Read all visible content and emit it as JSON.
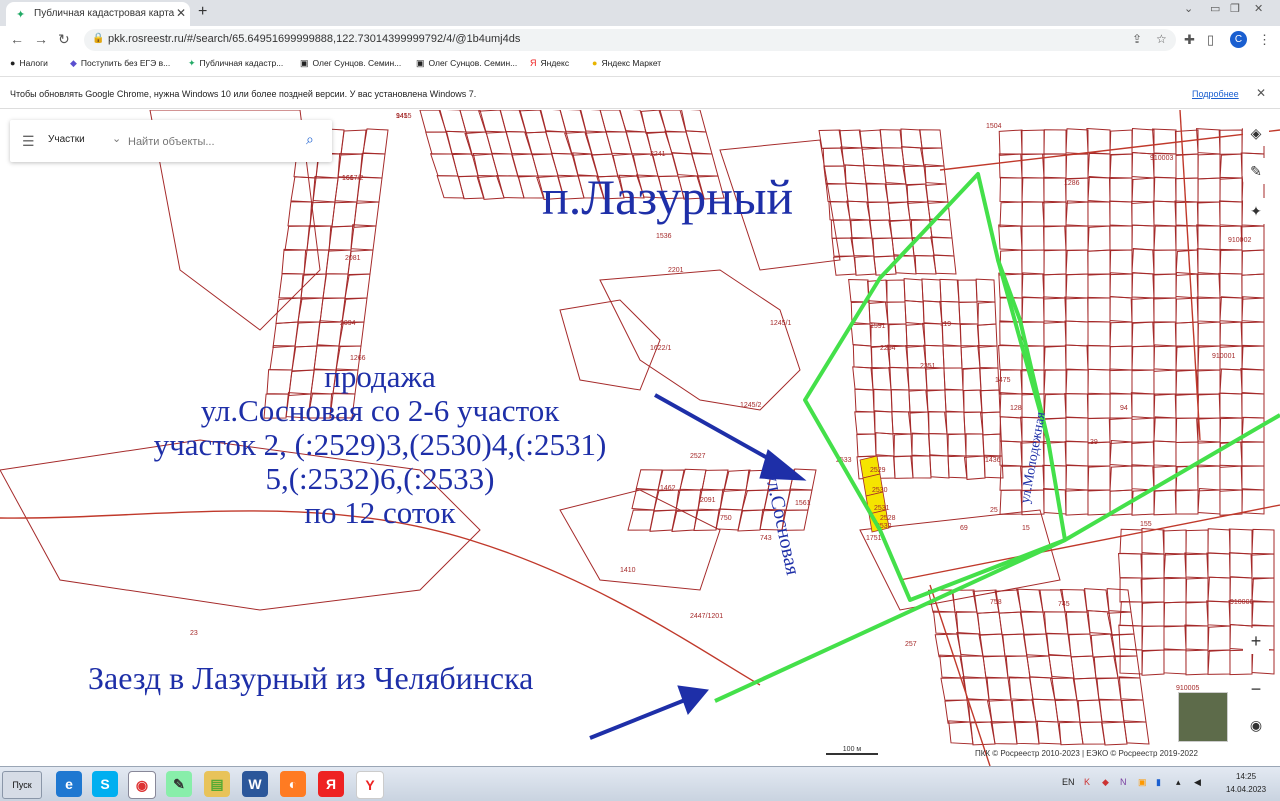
{
  "browser": {
    "tab_title": "Публичная кадастровая карта",
    "url": "pkk.rosreestr.ru/#/search/65.64951699999888,122.73014399999792/4/@1b4umj4ds",
    "avatar_letter": "C",
    "bookmarks": [
      {
        "label": "Налоги",
        "icon": "tax-icon"
      },
      {
        "label": "Поступить без ЕГЭ в...",
        "icon": "diamond-icon"
      },
      {
        "label": "Публичная кадастр...",
        "icon": "map-icon"
      },
      {
        "label": "Олег Сунцов. Семин...",
        "icon": "video-icon"
      },
      {
        "label": "Олег Сунцов. Семин...",
        "icon": "video-icon"
      },
      {
        "label": "Яндекс",
        "icon": "yandex-icon"
      },
      {
        "label": "Яндекс Маркет",
        "icon": "market-icon"
      }
    ],
    "infobar_message": "Чтобы обновлять Google Chrome, нужна Windows 10 или более поздней версии. У вас установлена Windows 7.",
    "infobar_link": "Подробнее"
  },
  "map": {
    "layer_label": "Участки",
    "search_placeholder": "Найти объекты...",
    "attribution": "ПКК © Росреестр 2010-2023 | ЕЭКО © Росреестр 2019-2022",
    "scale_label": "100 м",
    "parcel_numbers": [
      "1455",
      "1617/2",
      "2241",
      "1622/1",
      "2527",
      "1561",
      "1751",
      "1410",
      "23",
      "2447/1201",
      "1245/2",
      "1245/1",
      "2201",
      "1536",
      "1504",
      "1286",
      "2081",
      "2094",
      "1591",
      "1475",
      "1436",
      "910002",
      "910001",
      "910006",
      "910005",
      "910003",
      "257",
      "69",
      "2528",
      "2533",
      "2529",
      "2530",
      "2531",
      "2532",
      "119",
      "128",
      "94",
      "155",
      "39",
      "15",
      "25",
      "2351",
      "2264",
      "1266",
      "1462",
      "2091",
      "750",
      "743",
      "745",
      "758",
      "941",
      "166"
    ],
    "annotations": {
      "settlement": "п.Лазурный",
      "sale_line1": "продажа",
      "sale_line2": "ул.Сосновая со 2-6 участок",
      "sale_line3": "участок 2, (:2529)3,(2530)4,(:2531)",
      "sale_line4": "5,(:2532)6,(:2533)",
      "sale_line5": "по 12 соток",
      "entry": "Заезд в Лазурный из Челябинска",
      "street_sosnovaya": "ул.Сосновая",
      "street_molodezhnaya": "ул.Молодежная"
    },
    "colors": {
      "parcel": "#a52a2a",
      "boundary": "#44e04a",
      "annotation": "#1e2fa8",
      "highlight": "#f5e400"
    }
  },
  "taskbar": {
    "start_label": "Пуск",
    "apps": [
      "ie-icon",
      "skype-icon",
      "chrome-icon",
      "paint-icon",
      "explorer-icon",
      "word-icon",
      "firefox-icon",
      "yandex-browser-icon",
      "yandex-icon"
    ],
    "language": "EN",
    "time": "14:25",
    "date": "14.04.2023"
  }
}
